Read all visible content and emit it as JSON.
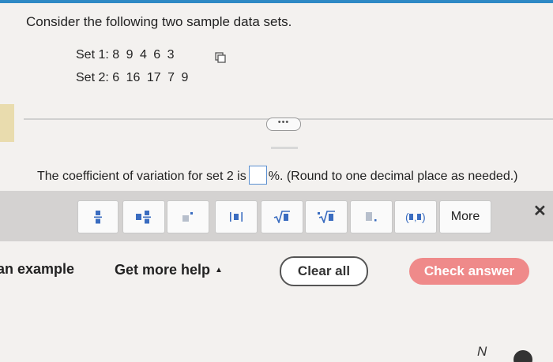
{
  "question": {
    "prompt": "Consider the following two sample data sets.",
    "set1_label": "Set 1:",
    "set1_values": "8 9 4 6 3",
    "set2_label": "Set 2:",
    "set2_values": "6 16 17 7 9"
  },
  "expand_label": "•••",
  "answer": {
    "prefix": "The coefficient of variation for set 2 is",
    "value": "",
    "suffix": "%. (Round to one decimal place as needed.)"
  },
  "toolbar": {
    "buttons": [
      {
        "label": "frac"
      },
      {
        "label": "mixed"
      },
      {
        "label": "exp"
      },
      {
        "label": "abs"
      },
      {
        "label": "sqrt"
      },
      {
        "label": "nroot"
      },
      {
        "label": "dec"
      },
      {
        "label": "interval"
      }
    ],
    "more_label": "More",
    "close_label": "✕"
  },
  "footer": {
    "example_label": "an example",
    "help_label": "Get more help",
    "help_caret": "▲",
    "clear_label": "Clear all",
    "check_label": "Check answer"
  },
  "corner": {
    "n_label": "N"
  },
  "colors": {
    "accent": "#2e89c5",
    "check_button": "#ef8a8a",
    "toolbar_bg": "#d4d2d1"
  }
}
